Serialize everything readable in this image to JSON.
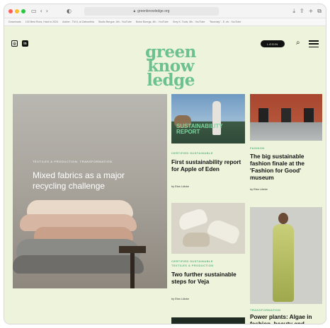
{
  "browser": {
    "url": "greenknowledge.org",
    "bookmarks": [
      "Downloads",
      "100 Best Runs, Hard to 2024",
      "Adobe - TM 6, at Zabruelbia",
      "Studio Bergue, 4th - YouTube",
      "Boise Buerga, 4th - YouTube",
      "Grey K. Tools, 5th - YouTube",
      "\"Noorday\" - E, eb - YouTube"
    ]
  },
  "header": {
    "logo": [
      "green",
      "know",
      "ledge"
    ],
    "login_label": "LOGIN",
    "instagram_icon": "instagram-icon",
    "linkedin_icon": "linkedin-icon"
  },
  "feature": {
    "kicker": "TEXTILES & PRODUCTION, TRANSFORMATION",
    "title": "Mixed fabrics as a major recycling challenge"
  },
  "cards": [
    {
      "image_label": "SUSTAINABILITY REPORT",
      "kicker": "CERTIFIED SUSTAINABLE",
      "title": "First sustainability report for Apple of Eden",
      "byline": "by Elea Lütcke"
    },
    {
      "kicker": "FASHION",
      "title": "The big sustainable fashion finale at the 'Fashion for Good' museum",
      "byline": "by Elea Lütcke"
    },
    {
      "kicker": "CERTIFIED SUSTAINABLE\nTEXTILES & PRODUCTION",
      "title": "Two further sustainable steps for Veja",
      "byline": "by Elea Lütcke"
    },
    {
      "kicker": "TRANSFORMATION",
      "title": "Power plants: Algae in fashion, beauty and"
    }
  ],
  "colors": {
    "page_bg": "#eef3dc",
    "brand_green": "#6cc18f",
    "kicker_green": "#5fb585"
  }
}
